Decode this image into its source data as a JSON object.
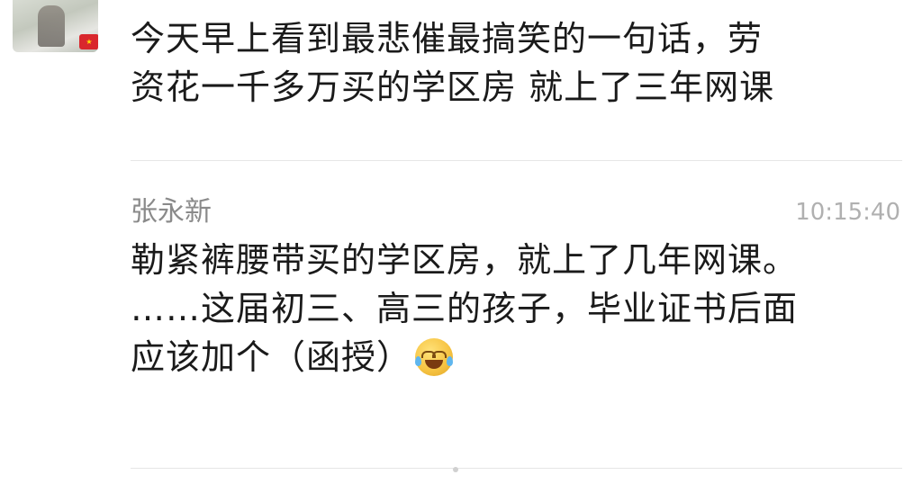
{
  "previous_message": {
    "avatar_badge": "★",
    "text": "今天早上看到最悲催最搞笑的一句话，劳\n资花一千多万买的学区房 就上了三年网课"
  },
  "comment": {
    "sender": "张永新",
    "time": "10:15:40",
    "text": "勒紧裤腰带买的学区房，就上了几年网课。\n……这届初三、高三的孩子，毕业证书后面\n应该加个（函授）",
    "emoji": "laugh-cry-emoji"
  },
  "colors": {
    "text": "#1a1a1a",
    "sender": "#8a8a8a",
    "time": "#b0b0b0",
    "divider": "#e6e6e6"
  }
}
